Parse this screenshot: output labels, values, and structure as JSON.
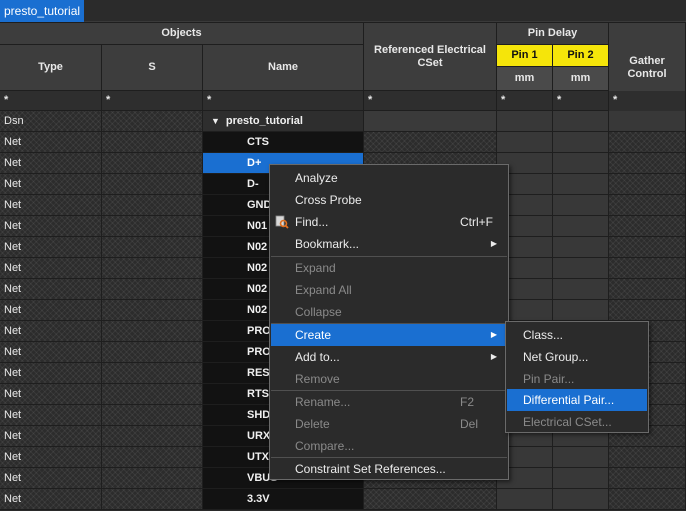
{
  "tab": {
    "label": "presto_tutorial"
  },
  "headers": {
    "objects": "Objects",
    "type": "Type",
    "s": "S",
    "name": "Name",
    "ref_cset": "Referenced Electrical CSet",
    "pin_delay": "Pin Delay",
    "pin1": "Pin 1",
    "pin2": "Pin 2",
    "pin1_unit": "mm",
    "pin2_unit": "mm",
    "gather_control": "Gather Control"
  },
  "filters": {
    "type": "*",
    "s": "*",
    "name": "*",
    "ref": "*",
    "pin1": "*",
    "pin2": "*",
    "gather": "*"
  },
  "rows": [
    {
      "type": "Dsn",
      "name": "presto_tutorial"
    },
    {
      "type": "Net",
      "name": "CTS"
    },
    {
      "type": "Net",
      "name": "D+"
    },
    {
      "type": "Net",
      "name": "D-"
    },
    {
      "type": "Net",
      "name": "GND"
    },
    {
      "type": "Net",
      "name": "N01"
    },
    {
      "type": "Net",
      "name": "N02"
    },
    {
      "type": "Net",
      "name": "N02"
    },
    {
      "type": "Net",
      "name": "N02"
    },
    {
      "type": "Net",
      "name": "N02"
    },
    {
      "type": "Net",
      "name": "PRO"
    },
    {
      "type": "Net",
      "name": "PRO"
    },
    {
      "type": "Net",
      "name": "RESI"
    },
    {
      "type": "Net",
      "name": "RTS"
    },
    {
      "type": "Net",
      "name": "SHD"
    },
    {
      "type": "Net",
      "name": "URX"
    },
    {
      "type": "Net",
      "name": "UTX"
    },
    {
      "type": "Net",
      "name": "VBUS"
    },
    {
      "type": "Net",
      "name": "3.3V"
    }
  ],
  "context_menu": {
    "analyze": "Analyze",
    "cross_probe": "Cross Probe",
    "find": "Find...",
    "find_shortcut": "Ctrl+F",
    "bookmark": "Bookmark...",
    "expand": "Expand",
    "expand_all": "Expand All",
    "collapse": "Collapse",
    "create": "Create",
    "add_to": "Add to...",
    "remove": "Remove",
    "rename": "Rename...",
    "rename_shortcut": "F2",
    "delete": "Delete",
    "delete_shortcut": "Del",
    "compare": "Compare...",
    "constraint_set_refs": "Constraint Set References..."
  },
  "submenu": {
    "class": "Class...",
    "net_group": "Net Group...",
    "pin_pair": "Pin Pair...",
    "differential_pair": "Differential Pair...",
    "electrical_cset": "Electrical CSet..."
  },
  "colors": {
    "accent": "#1a6fd1",
    "pin_header": "#f5e50a"
  }
}
